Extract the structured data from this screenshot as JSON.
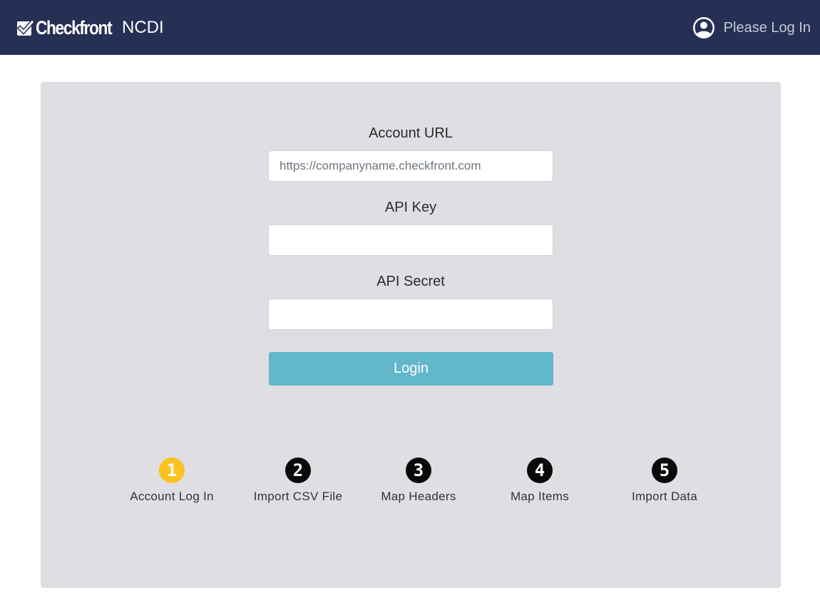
{
  "header": {
    "brand": "Checkfront",
    "app_name": "NCDI",
    "login_status": "Please Log In",
    "icons": {
      "brand": "checkbox-check-icon",
      "user": "user-circle-icon"
    }
  },
  "form": {
    "account_url": {
      "label": "Account URL",
      "placeholder": "https://companyname.checkfront.com",
      "value": ""
    },
    "api_key": {
      "label": "API Key",
      "placeholder": "",
      "value": ""
    },
    "api_secret": {
      "label": "API Secret",
      "placeholder": "",
      "value": ""
    },
    "login_button": "Login"
  },
  "steps": [
    {
      "number": "1",
      "label": "Account Log In",
      "active": true
    },
    {
      "number": "2",
      "label": "Import CSV File",
      "active": false
    },
    {
      "number": "3",
      "label": "Map Headers",
      "active": false
    },
    {
      "number": "4",
      "label": "Map Items",
      "active": false
    },
    {
      "number": "5",
      "label": "Import Data",
      "active": false
    }
  ],
  "colors": {
    "navbar": "#262f54",
    "panel": "#dfdfe3",
    "button": "#62b7ca",
    "active_step": "#fbc31f",
    "inactive_step": "#0a0a0a"
  }
}
